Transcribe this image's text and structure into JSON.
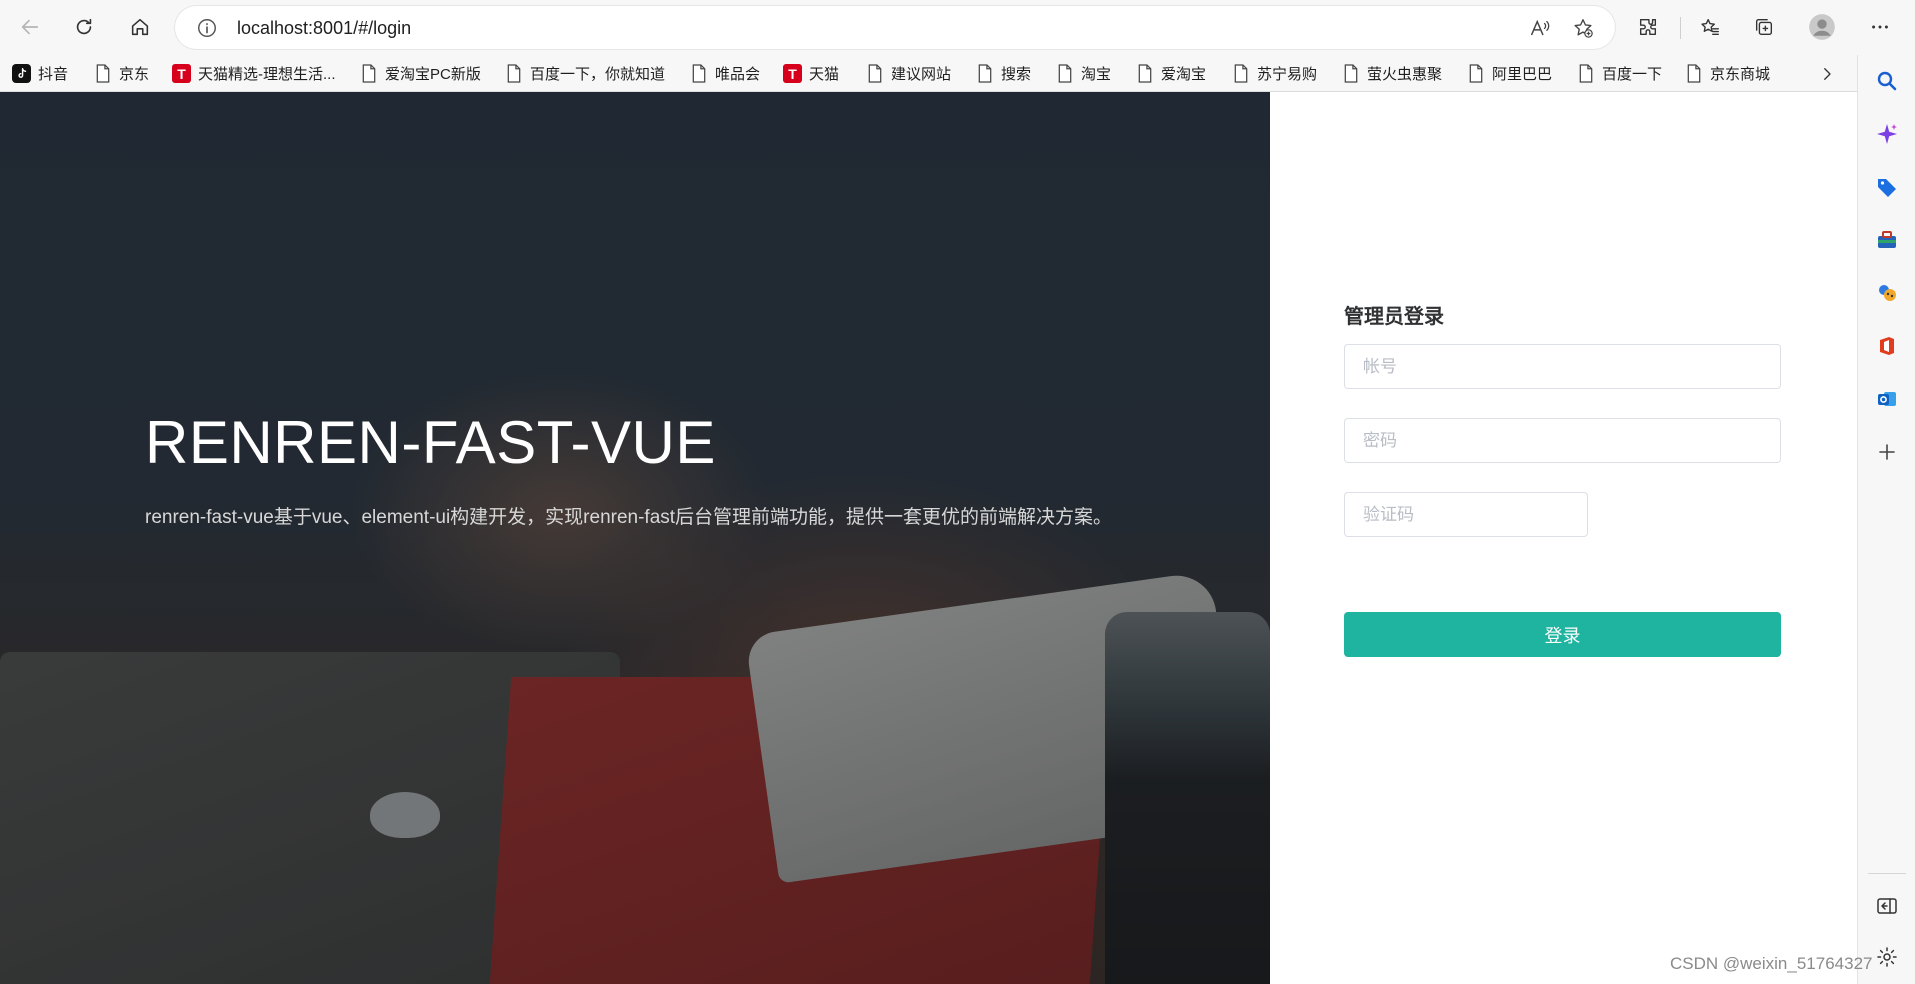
{
  "browser": {
    "url": "localhost:8001/#/login",
    "icons": {
      "back": "back-arrow-icon",
      "refresh": "refresh-icon",
      "home": "home-icon",
      "info": "info-icon",
      "read_aloud": "read-aloud-icon",
      "favorite_add": "favorite-add-icon",
      "extensions": "extensions-icon",
      "favorites": "favorites-icon",
      "collections": "collections-icon",
      "profile": "profile-avatar-icon",
      "menu": "more-menu-icon"
    }
  },
  "bookmarks": [
    {
      "label": "抖音",
      "icon": "douyin-icon"
    },
    {
      "label": "京东",
      "icon": "page-icon"
    },
    {
      "label": "天猫精选-理想生活...",
      "icon": "tmall-icon"
    },
    {
      "label": "爱淘宝PC新版",
      "icon": "page-icon"
    },
    {
      "label": "百度一下，你就知道",
      "icon": "page-icon"
    },
    {
      "label": "唯品会",
      "icon": "page-icon"
    },
    {
      "label": "天猫",
      "icon": "tmall-icon"
    },
    {
      "label": "建议网站",
      "icon": "page-icon"
    },
    {
      "label": "搜索",
      "icon": "page-icon"
    },
    {
      "label": "淘宝",
      "icon": "page-icon"
    },
    {
      "label": "爱淘宝",
      "icon": "page-icon"
    },
    {
      "label": "苏宁易购",
      "icon": "page-icon"
    },
    {
      "label": "萤火虫惠聚",
      "icon": "page-icon"
    },
    {
      "label": "阿里巴巴",
      "icon": "page-icon"
    },
    {
      "label": "百度一下",
      "icon": "page-icon"
    },
    {
      "label": "京东商城",
      "icon": "page-icon"
    }
  ],
  "hero": {
    "title": "RENREN-FAST-VUE",
    "description": "renren-fast-vue基于vue、element-ui构建开发，实现renren-fast后台管理前端功能，提供一套更优的前端解决方案。"
  },
  "login": {
    "title": "管理员登录",
    "username": {
      "value": "",
      "placeholder": "帐号"
    },
    "password": {
      "value": "",
      "placeholder": "密码"
    },
    "captcha": {
      "value": "",
      "placeholder": "验证码"
    },
    "submit_label": "登录",
    "accent_color": "#1eb49f"
  },
  "sidebar": {
    "icons": [
      "search-icon",
      "copilot-icon",
      "shopping-tag-icon",
      "tools-icon",
      "games-icon",
      "office-icon",
      "outlook-icon",
      "add-icon",
      "hide-sidebar-icon",
      "settings-icon"
    ]
  },
  "watermark": "CSDN @weixin_51764327"
}
